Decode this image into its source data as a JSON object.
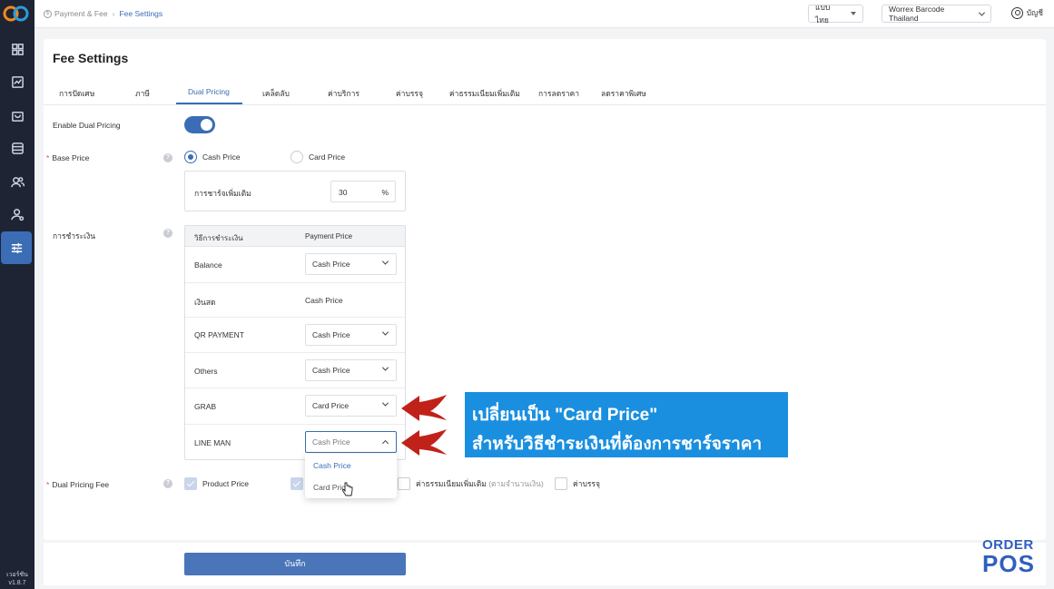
{
  "sidebar": {
    "version_label": "เวอร์ชัน",
    "version_number": "v1.8.7",
    "items": [
      {
        "icon": "dashboard-icon"
      },
      {
        "icon": "reports-icon"
      },
      {
        "icon": "bag-icon"
      },
      {
        "icon": "database-icon"
      },
      {
        "icon": "users-icon"
      },
      {
        "icon": "user-settings-icon"
      },
      {
        "icon": "sliders-icon",
        "active": true
      }
    ]
  },
  "topbar": {
    "breadcrumb_root": "Payment & Fee",
    "breadcrumb_current": "Fee Settings",
    "language": "แบบไทย",
    "store": "Worrex Barcode Thailand",
    "account": "บัญชี"
  },
  "page": {
    "title": "Fee Settings",
    "tabs": [
      "การปัดเศษ",
      "ภาษี",
      "Dual Pricing",
      "เคล็ดลับ",
      "ค่าบริการ",
      "ค่าบรรจุ",
      "ค่าธรรมเนียมเพิ่มเติม",
      "การลดราคา",
      "ลดราคาพิเศษ"
    ],
    "active_tab": "Dual Pricing"
  },
  "form": {
    "enable_label": "Enable Dual Pricing",
    "enable_value": true,
    "base_price_label": "Base Price",
    "base_options": [
      "Cash Price",
      "Card Price"
    ],
    "base_selected": "Cash Price",
    "surcharge_label": "การชาร์จเพิ่มเติม",
    "surcharge_value": "30",
    "surcharge_unit": "%",
    "payment_label": "การชำระเงิน",
    "table_headers": [
      "วิธีการชำระเงิน",
      "Payment Price"
    ],
    "payment_rows": [
      {
        "method": "Balance",
        "price": "Cash Price",
        "editable": true
      },
      {
        "method": "เงินสด",
        "price": "Cash Price",
        "editable": false
      },
      {
        "method": "QR PAYMENT",
        "price": "Cash Price",
        "editable": true
      },
      {
        "method": "Others",
        "price": "Cash Price",
        "editable": true
      },
      {
        "method": "GRAB",
        "price": "Card Price",
        "editable": true
      },
      {
        "method": "LINE MAN",
        "price": "Cash Price",
        "editable": true,
        "open": true
      }
    ],
    "dropdown_options": [
      "Cash Price",
      "Card Price"
    ],
    "fee_label": "Dual Pricing Fee",
    "fee_items": [
      {
        "label": "Product Price",
        "checked": true
      },
      {
        "label": "ค่าธรรมเนียมเพิ่มเติม",
        "note": "(ตามจำนวนเงิน)",
        "checked": false
      },
      {
        "label": "ค่าบรรจุ",
        "checked": false
      }
    ],
    "save_label": "บันทึก"
  },
  "annotation": {
    "line1": "เปลี่ยนเป็น \"Card Price\"",
    "line2": "สำหรับวิธีชำระเงินที่ต้องการชาร์จราคา",
    "color": "#1a8fe0",
    "arrow_color": "#c0221a"
  },
  "brand": {
    "line1": "ORDER",
    "line2": "POS"
  },
  "colors": {
    "accent": "#3a6db5",
    "sidebar": "#1e2433",
    "required": "#e24a4a"
  }
}
